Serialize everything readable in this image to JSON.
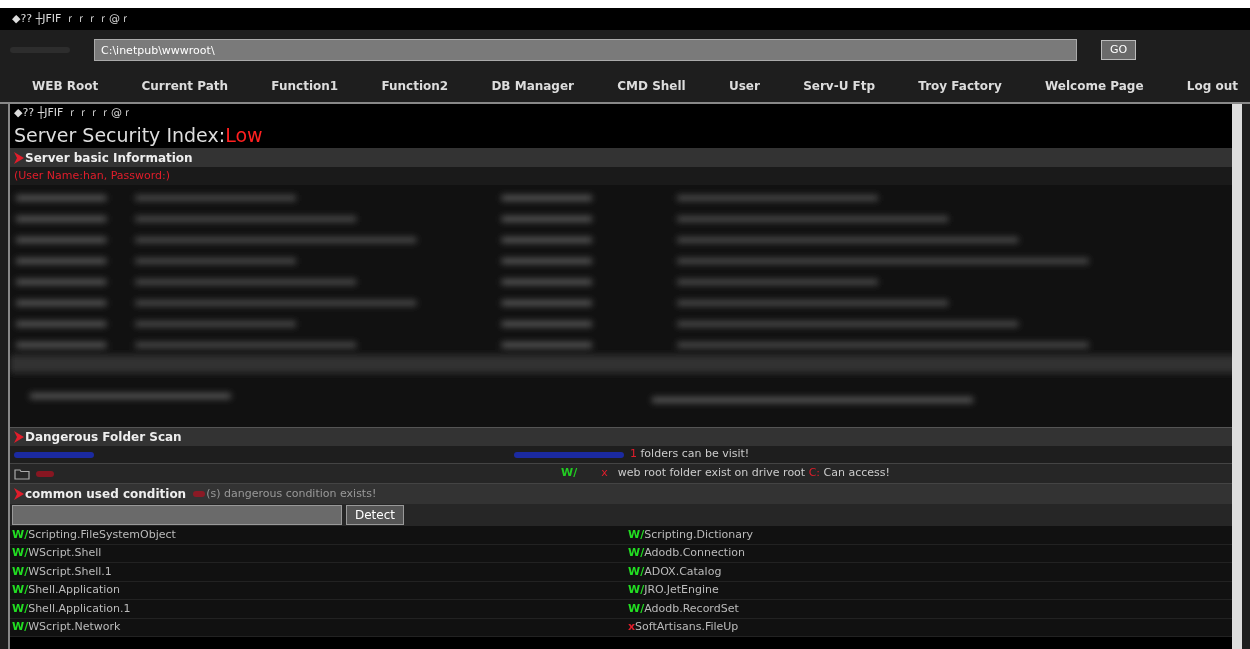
{
  "top_banner": "◆?? ┼JFIF ｒｒｒｒ@ｒ",
  "address_bar": {
    "value": "C:\\inetpub\\wwwroot\\",
    "button": "GO"
  },
  "nav": [
    "WEB Root",
    "Current Path",
    "Function1",
    "Function2",
    "DB Manager",
    "CMD Shell",
    "User",
    "Serv-U Ftp",
    "Troy Factory",
    "Welcome Page",
    "Log out"
  ],
  "content_banner": "◆?? ┼JFIF ｒｒｒｒ@ｒ",
  "security": {
    "label": "Server Security Index:",
    "value": "Low"
  },
  "sections": [
    {
      "title": "Server basic Information",
      "note": "(User Name:han, Password:)"
    }
  ],
  "folder_scan": {
    "title": "Dangerous Folder Scan",
    "count": "1",
    "summary": " folders can be visit!",
    "rows": [
      {
        "write": "W/",
        "read_ok": false,
        "status": "x",
        "message": "web root folder exist on drive root ",
        "drive": "C:",
        "message_end": " Can access!"
      }
    ]
  },
  "condition": {
    "title": "common used condition",
    "message": "(s) dangerous condition exists!",
    "button": "Detect",
    "items": [
      {
        "ok": true,
        "mark": "W/",
        "name": "Scripting.FileSystemObject"
      },
      {
        "ok": true,
        "mark": "W/",
        "name": "Scripting.Dictionary"
      },
      {
        "ok": true,
        "mark": "W/",
        "name": "WScript.Shell"
      },
      {
        "ok": true,
        "mark": "W/",
        "name": "Adodb.Connection"
      },
      {
        "ok": true,
        "mark": "W/",
        "name": "WScript.Shell.1"
      },
      {
        "ok": true,
        "mark": "W/",
        "name": "ADOX.Catalog"
      },
      {
        "ok": true,
        "mark": "W/",
        "name": "Shell.Application"
      },
      {
        "ok": true,
        "mark": "W/",
        "name": "JRO.JetEngine"
      },
      {
        "ok": true,
        "mark": "W/",
        "name": "Shell.Application.1"
      },
      {
        "ok": true,
        "mark": "W/",
        "name": "Adodb.RecordSet"
      },
      {
        "ok": true,
        "mark": "W/",
        "name": "WScript.Network"
      },
      {
        "ok": false,
        "mark": "x",
        "name": "SoftArtisans.FileUp"
      }
    ]
  }
}
